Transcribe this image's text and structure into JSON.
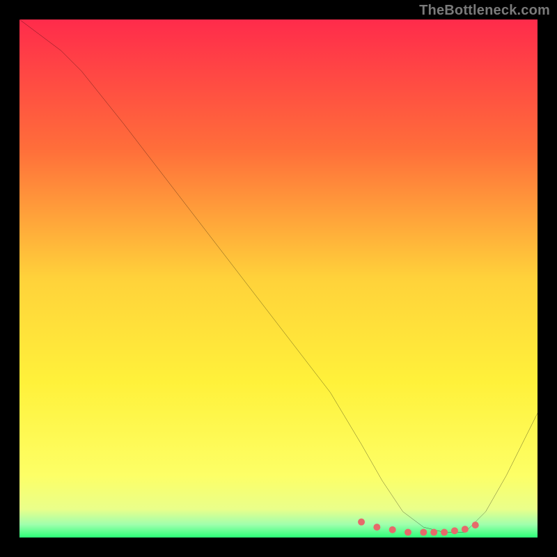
{
  "watermark": "TheBottleneck.com",
  "chart_data": {
    "type": "line",
    "title": "",
    "xlabel": "",
    "ylabel": "",
    "xlim": [
      0,
      100
    ],
    "ylim": [
      0,
      100
    ],
    "grid": false,
    "legend": false,
    "background_gradient": {
      "stops": [
        {
          "offset": 0.0,
          "color": "#ff2b4b"
        },
        {
          "offset": 0.25,
          "color": "#ff6e3a"
        },
        {
          "offset": 0.5,
          "color": "#ffd23a"
        },
        {
          "offset": 0.7,
          "color": "#fff13a"
        },
        {
          "offset": 0.88,
          "color": "#fdff66"
        },
        {
          "offset": 0.945,
          "color": "#eaff8a"
        },
        {
          "offset": 0.975,
          "color": "#9fffad"
        },
        {
          "offset": 1.0,
          "color": "#2bff78"
        }
      ]
    },
    "series": [
      {
        "name": "bottleneck-curve",
        "color": "#000000",
        "width": 2.2,
        "x": [
          0,
          4,
          8,
          12,
          20,
          30,
          40,
          50,
          60,
          66,
          70,
          74,
          78,
          82,
          86,
          90,
          94,
          98,
          100
        ],
        "y": [
          100,
          97,
          94,
          90,
          80,
          67,
          54,
          41,
          28,
          18,
          11,
          5,
          2,
          1,
          1,
          5,
          12,
          20,
          24
        ]
      }
    ],
    "valley_marker": {
      "color": "#e66a6a",
      "radius": 5,
      "x": [
        66,
        69,
        72,
        75,
        78,
        80,
        82,
        84,
        86,
        88
      ],
      "y": [
        3,
        2,
        1.5,
        1,
        1,
        1,
        1,
        1.3,
        1.6,
        2.4
      ]
    }
  }
}
